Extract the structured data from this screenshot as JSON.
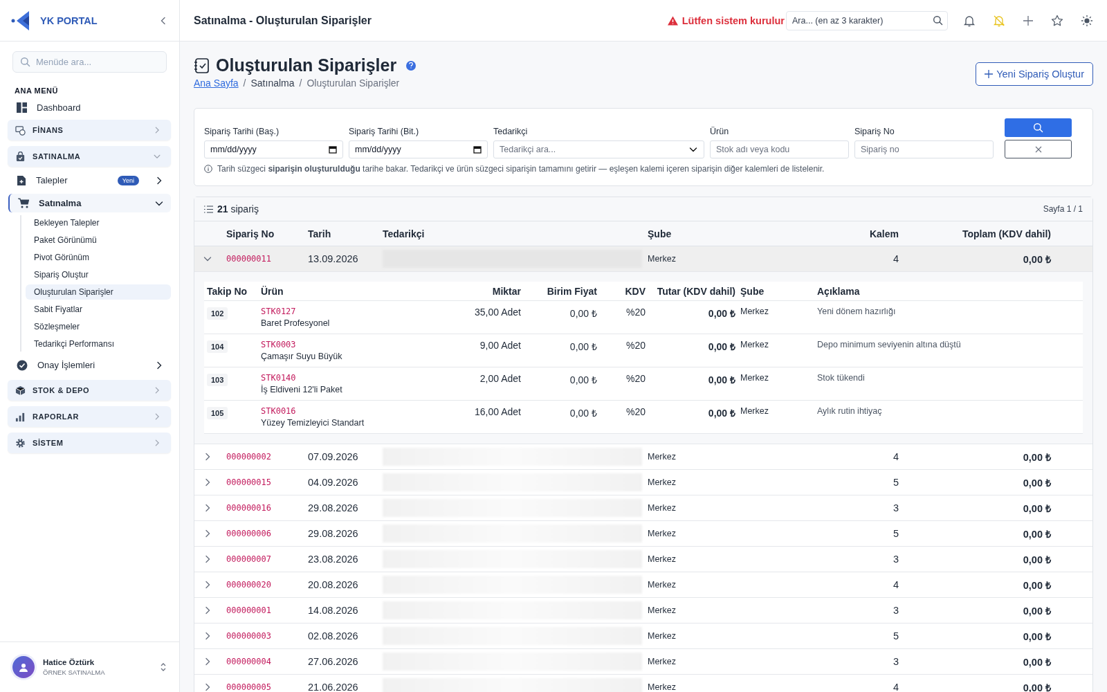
{
  "sidebar": {
    "brand": "YK PORTAL",
    "search": {
      "placeholder": "Menüde ara..."
    },
    "section_title": "ANA MENÜ",
    "items": [
      {
        "kind": "link",
        "label": "Dashboard"
      },
      {
        "kind": "group",
        "label": "FİNANS",
        "expanded": false
      },
      {
        "kind": "group",
        "label": "SATINALMA",
        "expanded": true,
        "children": [
          {
            "label": "Talepler",
            "badge": "Yeni",
            "expanded": false
          },
          {
            "label": "Satınalma",
            "expanded": true,
            "children": [
              {
                "label": "Bekleyen Talepler",
                "selected": false
              },
              {
                "label": "Paket Görünümü",
                "selected": false
              },
              {
                "label": "Pivot Görünüm",
                "selected": false
              },
              {
                "label": "Sipariş Oluştur",
                "selected": false
              },
              {
                "label": "Oluşturulan Siparişler",
                "selected": true
              },
              {
                "label": "Sabit Fiyatlar",
                "selected": false
              },
              {
                "label": "Sözleşmeler",
                "selected": false
              },
              {
                "label": "Tedarikçi Performansı",
                "selected": false
              }
            ]
          },
          {
            "label": "Onay İşlemleri",
            "expanded": false
          }
        ]
      },
      {
        "kind": "group",
        "label": "STOK & DEPO",
        "expanded": false
      },
      {
        "kind": "group",
        "label": "RAPORLAR",
        "expanded": false
      },
      {
        "kind": "group",
        "label": "SİSTEM",
        "expanded": false
      }
    ],
    "user": {
      "name": "Hatice Öztürk",
      "role": "ÖRNEK SATINALMA"
    }
  },
  "topbar": {
    "title": "Satınalma - Oluşturulan Siparişler",
    "warning": "Lütfen sistem kurulur",
    "search": {
      "placeholder": "Ara... (en az 3 karakter)"
    }
  },
  "page": {
    "title": "Oluşturulan Siparişler",
    "breadcrumb": [
      "Ana Sayfa",
      "Satınalma",
      "Oluşturulan Siparişler"
    ],
    "breadcrumb_separator": "/",
    "new_button": "Yeni Sipariş Oluştur"
  },
  "filters": {
    "fields": [
      {
        "kind": "date",
        "label": "Sipariş Tarihi (Baş.)",
        "placeholder": "mm/dd/yyyy"
      },
      {
        "kind": "date",
        "label": "Sipariş Tarihi (Bit.)",
        "placeholder": "mm/dd/yyyy"
      },
      {
        "kind": "select",
        "label": "Tedarikçi",
        "placeholder": "Tedarikçi ara..."
      },
      {
        "kind": "text",
        "label": "Ürün",
        "placeholder": "Stok adı veya kodu"
      },
      {
        "kind": "text",
        "label": "Sipariş No",
        "placeholder": "Sipariş no"
      }
    ],
    "note": "Tarih süzgeci **siparişin oluşturulduğu** tarihe bakar. Tedarikçi ve ürün süzgeci siparişin tamamını getirir — eşleşen kalemi içeren siparişin diğer kalemleri de listelenir."
  },
  "orders": {
    "count": "21",
    "count_label": "sipariş",
    "page_info": "Sayfa 1 / 1",
    "columns": [
      "Sipariş No",
      "Tarih",
      "Tedarikçi",
      "Şube",
      "Kalem",
      "Toplam (KDV dahil)"
    ],
    "detail_columns": [
      "Takip No",
      "Ürün",
      "Miktar",
      "Birim Fiyat",
      "KDV",
      "Tutar (KDV dahil)",
      "Şube",
      "Açıklama"
    ],
    "rows": [
      {
        "no": "000000011",
        "date": "13.09.2026",
        "branch": "Merkez",
        "items": "4",
        "total": "0,00 ₺",
        "expanded": true,
        "lines": [
          {
            "tracking": "102",
            "code": "STK0127",
            "name": "Baret Profesyonel",
            "qty": "35,00 Adet",
            "unit_price": "0,00 ₺",
            "vat": "%20",
            "total": "0,00 ₺",
            "branch": "Merkez",
            "note": "Yeni dönem hazırlığı"
          },
          {
            "tracking": "104",
            "code": "STK0003",
            "name": "Çamaşır Suyu Büyük",
            "qty": "9,00 Adet",
            "unit_price": "0,00 ₺",
            "vat": "%20",
            "total": "0,00 ₺",
            "branch": "Merkez",
            "note": "Depo minimum seviyenin altına düştü"
          },
          {
            "tracking": "103",
            "code": "STK0140",
            "name": "İş Eldiveni 12'li Paket",
            "qty": "2,00 Adet",
            "unit_price": "0,00 ₺",
            "vat": "%20",
            "total": "0,00 ₺",
            "branch": "Merkez",
            "note": "Stok tükendi"
          },
          {
            "tracking": "105",
            "code": "STK0016",
            "name": "Yüzey Temizleyici Standart",
            "qty": "16,00 Adet",
            "unit_price": "0,00 ₺",
            "vat": "%20",
            "total": "0,00 ₺",
            "branch": "Merkez",
            "note": "Aylık rutin ihtiyaç"
          }
        ]
      },
      {
        "no": "000000002",
        "date": "07.09.2026",
        "branch": "Merkez",
        "items": "4",
        "total": "0,00 ₺",
        "expanded": false
      },
      {
        "no": "000000015",
        "date": "04.09.2026",
        "branch": "Merkez",
        "items": "5",
        "total": "0,00 ₺",
        "expanded": false
      },
      {
        "no": "000000016",
        "date": "29.08.2026",
        "branch": "Merkez",
        "items": "3",
        "total": "0,00 ₺",
        "expanded": false
      },
      {
        "no": "000000006",
        "date": "29.08.2026",
        "branch": "Merkez",
        "items": "5",
        "total": "0,00 ₺",
        "expanded": false
      },
      {
        "no": "000000007",
        "date": "23.08.2026",
        "branch": "Merkez",
        "items": "3",
        "total": "0,00 ₺",
        "expanded": false
      },
      {
        "no": "000000020",
        "date": "20.08.2026",
        "branch": "Merkez",
        "items": "4",
        "total": "0,00 ₺",
        "expanded": false
      },
      {
        "no": "000000001",
        "date": "14.08.2026",
        "branch": "Merkez",
        "items": "3",
        "total": "0,00 ₺",
        "expanded": false
      },
      {
        "no": "000000003",
        "date": "02.08.2026",
        "branch": "Merkez",
        "items": "5",
        "total": "0,00 ₺",
        "expanded": false
      },
      {
        "no": "000000004",
        "date": "27.06.2026",
        "branch": "Merkez",
        "items": "3",
        "total": "0,00 ₺",
        "expanded": false
      },
      {
        "no": "000000005",
        "date": "21.06.2026",
        "branch": "Merkez",
        "items": "4",
        "total": "0,00 ₺",
        "expanded": false
      }
    ]
  }
}
